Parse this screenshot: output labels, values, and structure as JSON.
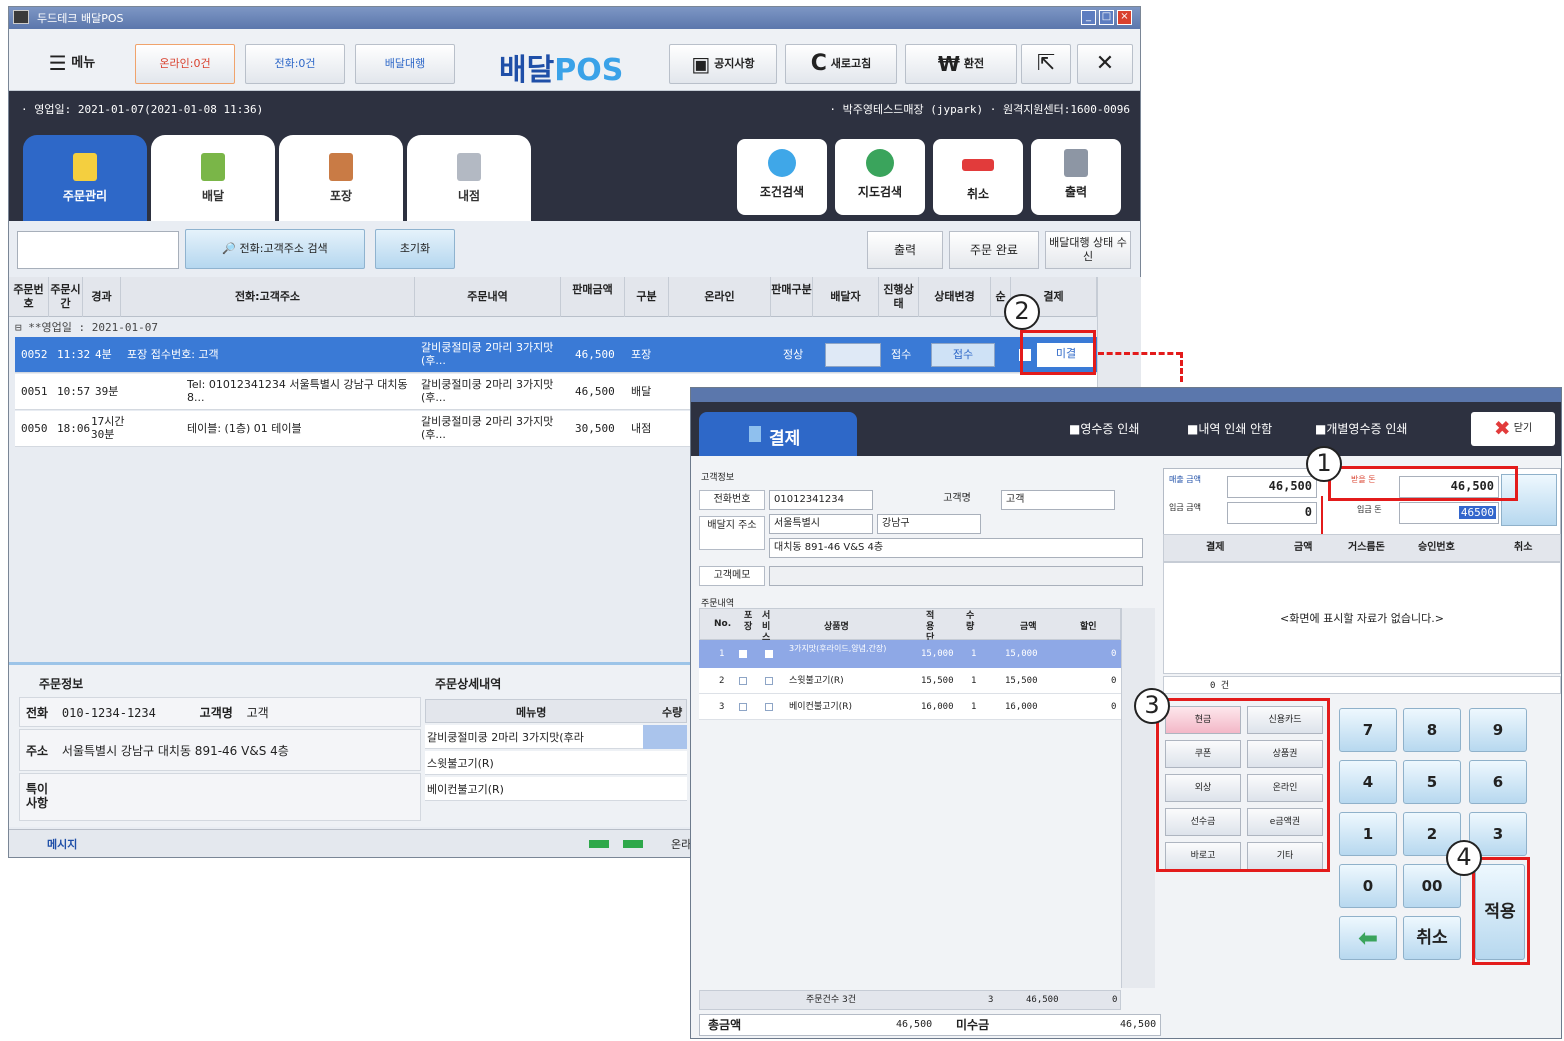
{
  "app": {
    "title": "두드테크 배달POS"
  },
  "toolbar": {
    "menu": "메뉴",
    "online": "온라인:0건",
    "phone": "전화:0건",
    "delivery_agent": "배달대행",
    "logo_a": "배달",
    "logo_b": "POS",
    "notice": "공지사항",
    "refresh": "새로고침",
    "exchange": "환전",
    "logo_c": "C",
    "won": "₩"
  },
  "info": {
    "left": "· 영업일: 2021-01-07(2021-01-08 11:36)",
    "right": "· 박주영테스드매장 (jypark) · 원격지원센터:1600-0096"
  },
  "tabs": [
    "주문관리",
    "배달",
    "포장",
    "내점"
  ],
  "right_tabs": [
    "조건검색",
    "지도검색",
    "취소",
    "출력"
  ],
  "search": {
    "btn": "전화:고객주소 검색",
    "reset": "초기화",
    "print": "출력",
    "complete": "주문 완료",
    "receive": "배달대행 상태 수신"
  },
  "columns": [
    "주문번호",
    "주문시간",
    "경과",
    "전화:고객주소",
    "주문내역",
    "판매금액",
    "구분",
    "온라인",
    "판매구분",
    "배달자",
    "진행상태",
    "상태변경",
    "순",
    "결제"
  ],
  "group": "⊟ **영업일 : 2021-01-07",
  "orders": [
    {
      "no": "0052",
      "time": "11:32",
      "elapsed": "4분",
      "addr": "포장 접수번호: 고객",
      "items": "갈비쿵절미쿵 2마리 3가지맛(후...",
      "amount": "46,500",
      "type": "포장",
      "sale": "정상",
      "status": "접수",
      "change": "접수",
      "pay": "미결"
    },
    {
      "no": "0051",
      "time": "10:57",
      "elapsed": "39분",
      "addr": "Tel: 01012341234 서울특별시 강남구 대치동 8...",
      "items": "갈비쿵절미쿵 2마리 3가지맛(후...",
      "amount": "46,500",
      "type": "배달",
      "sale": "",
      "status": "",
      "change": "",
      "pay": ""
    },
    {
      "no": "0050",
      "time": "18:06",
      "elapsed": "17시간 30분",
      "addr": "테이블: (1층) 01 테이블",
      "items": "갈비쿵절미쿵 2마리 3가지맛(후...",
      "amount": "30,500",
      "type": "내점",
      "sale": "",
      "status": "",
      "change": "",
      "pay": ""
    }
  ],
  "bottom": {
    "order_info": "주문정보",
    "detail": "주문상세내역",
    "phone_label": "전화",
    "phone": "010-1234-1234",
    "cust_label": "고객명",
    "cust": "고객",
    "addr_label": "주소",
    "addr": "서울특별시 강남구 대치동 891-46 V&S 4층",
    "memo_label": "특이 사항",
    "menu_col": "메뉴명",
    "qty_col": "수량",
    "menus": [
      "갈비쿵절미쿵 2마리 3가지맛(후라",
      "스윗불고기(R)",
      "베이컨불고기(R)"
    ],
    "status": "메시지",
    "status_right": "온라"
  },
  "pay": {
    "title": "결제",
    "opt1": "■영수증 인쇄",
    "opt2": "■내역 인쇄 안함",
    "opt3": "■개별영수증 인쇄",
    "close": "닫기",
    "cust_section": "고객정보",
    "phone_label": "전화번호",
    "phone": "01012341234",
    "name_label": "고객명",
    "name": "고객",
    "addr_label": "배달지 주소",
    "addr1": "서울특별시",
    "addr2": "강남구",
    "addr3": "대치동 891-46 V&S 4층",
    "memo_label": "고객메모",
    "items_section": "주문내역",
    "item_cols": [
      "No.",
      "포장",
      "서비스",
      "상품명",
      "적용단가",
      "수량",
      "금액",
      "할인"
    ],
    "items": [
      {
        "no": "1",
        "name": "3가지맛(후라이드,양념,간장)",
        "price": "15,000",
        "qty": "1",
        "amt": "15,000",
        "disc": "0"
      },
      {
        "no": "2",
        "name": "스윗불고기(R)",
        "price": "15,500",
        "qty": "1",
        "amt": "15,500",
        "disc": "0"
      },
      {
        "no": "3",
        "name": "베이컨불고기(R)",
        "price": "16,000",
        "qty": "1",
        "amt": "16,000",
        "disc": "0"
      }
    ],
    "total_count": "주문건수 3건",
    "total_qty": "3",
    "total_amt": "46,500",
    "total_disc": "0",
    "sum_label": "총금액",
    "sum": "46,500",
    "unpaid_label": "미수금",
    "unpaid": "46,500",
    "sale_label": "매출 금액",
    "sale": "46,500",
    "recv_label": "받을 돈",
    "recv": "46,500",
    "paid_label": "입금 금액",
    "paid": "0",
    "input_label": "입금 돈",
    "input": "46500",
    "pay_cols": [
      "결제",
      "금액",
      "거스름돈",
      "승인번호",
      "취소"
    ],
    "empty": "<화면에 표시할 자료가 없습니다.>",
    "count": "0 건",
    "methods": [
      "현금",
      "신용카드",
      "쿠폰",
      "상품권",
      "외상",
      "온라인",
      "선수금",
      "e금액권",
      "바로고",
      "기타"
    ],
    "keys": [
      "7",
      "8",
      "9",
      "4",
      "5",
      "6",
      "1",
      "2",
      "3",
      "0",
      "00"
    ],
    "cancel": "취소",
    "apply": "적용"
  },
  "annotations": [
    "1",
    "2",
    "3",
    "4"
  ]
}
